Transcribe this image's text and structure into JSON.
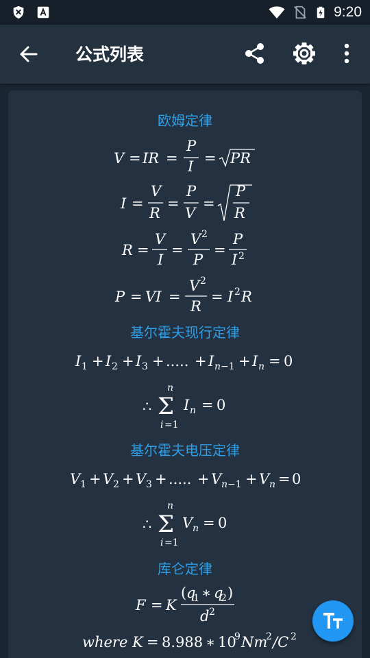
{
  "status_bar": {
    "time": "9:20",
    "icons": [
      "shield-x-icon",
      "font-a-icon",
      "wifi-icon",
      "no-sim-icon",
      "battery-charging-icon"
    ]
  },
  "app_bar": {
    "title": "公式列表",
    "icons": [
      "back-arrow-icon",
      "share-icon",
      "settings-gear-icon",
      "more-vert-icon"
    ]
  },
  "sections": [
    {
      "title": "欧姆定律",
      "formulas": [
        "V = IR = P/I = √(PR)",
        "I = V/R = P/V = √(P/R)",
        "R = V/I = V²/P = P/I²",
        "P = VI = V²/R = I²R"
      ]
    },
    {
      "title": "基尔霍夫现行定律",
      "formulas": [
        "I₁ + I₂ + I₃ + ..... + Iₙ₋₁ + Iₙ = 0",
        "∴ Σ_{i=1}^{n} Iₙ = 0"
      ]
    },
    {
      "title": "基尔霍夫电压定律",
      "formulas": [
        "V₁ + V₂ + V₃ + ..... + Vₙ₋₁ + Vₙ = 0",
        "∴ Σ_{i=1}^{n} Vₙ = 0"
      ]
    },
    {
      "title": "库仑定律",
      "formulas": [
        "F = K (q₁ * q₂)/d²",
        "where K = 8.988 * 10⁹ Nm²/C²"
      ]
    }
  ],
  "fab": {
    "icon": "text-size-icon"
  },
  "colors": {
    "accent": "#2f9ee6",
    "background": "#1b2633",
    "card": "#243140",
    "fab": "#2196f3"
  }
}
